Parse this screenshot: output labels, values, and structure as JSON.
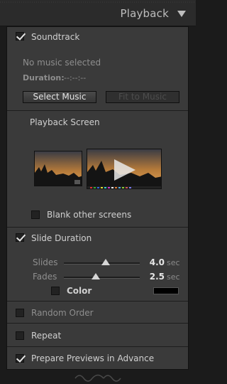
{
  "header": {
    "title": "Playback",
    "collapse_icon": "triangle-down-icon"
  },
  "soundtrack": {
    "label": "Soundtrack",
    "checked": true,
    "status": "No music selected",
    "duration_label": "Duration:",
    "duration_value": "--:--:--",
    "select_button": "Select Music",
    "fit_button": "Fit to Music"
  },
  "playback_screen": {
    "title": "Playback Screen",
    "blank_other_label": "Blank other screens",
    "blank_other_checked": false
  },
  "slide_duration": {
    "label": "Slide Duration",
    "checked": true,
    "slides_label": "Slides",
    "slides_value": "4.0",
    "slides_level": 0.55,
    "fades_label": "Fades",
    "fades_value": "2.5",
    "fades_level": 0.42,
    "unit": "sec",
    "color_label": "Color",
    "color_checked": false,
    "color_swatch": "#000000"
  },
  "random_order": {
    "label": "Random Order",
    "checked": false
  },
  "repeat": {
    "label": "Repeat",
    "checked": false
  },
  "prepare_previews": {
    "label": "Prepare Previews in Advance",
    "checked": true
  }
}
